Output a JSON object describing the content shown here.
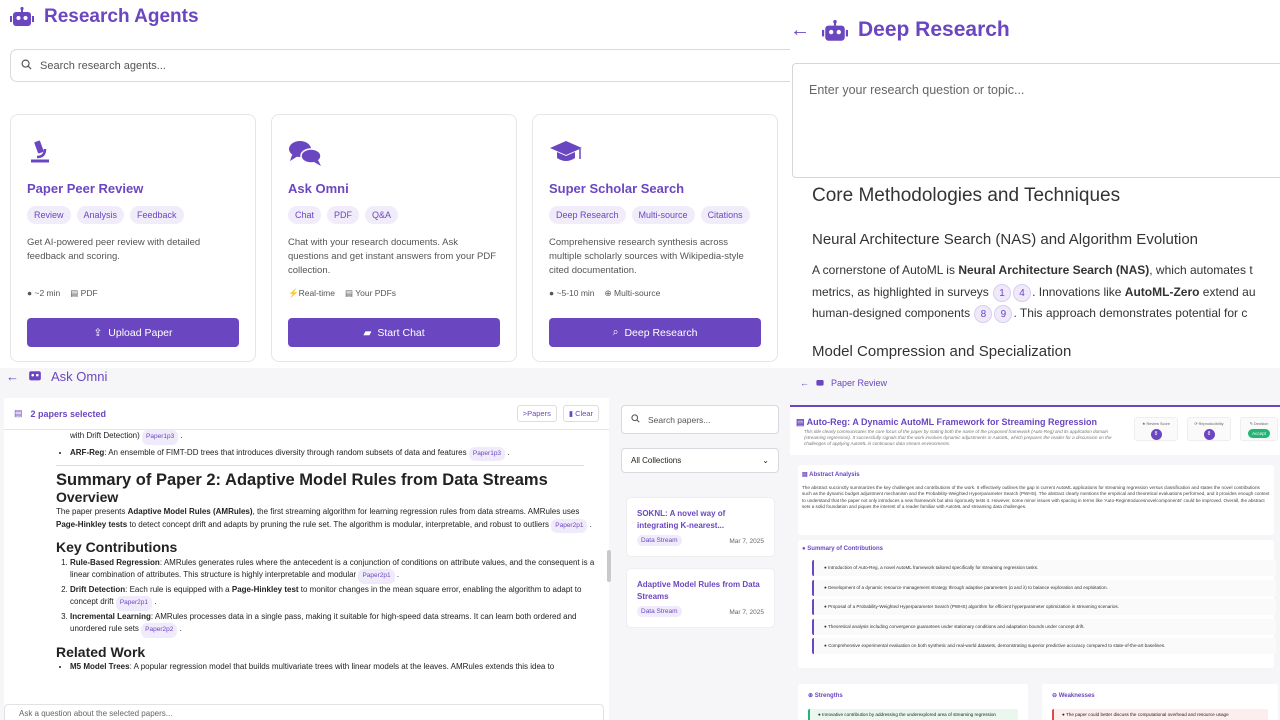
{
  "q1": {
    "app_title": "Research Agents",
    "search_placeholder": "Search research agents...",
    "cards": [
      {
        "title": "Paper Peer Review",
        "tags": [
          "Review",
          "Analysis",
          "Feedback"
        ],
        "desc": "Get AI-powered peer review with detailed feedback and scoring.",
        "meta": [
          "~2 min",
          "PDF"
        ],
        "button": "Upload Paper"
      },
      {
        "title": "Ask Omni",
        "tags": [
          "Chat",
          "PDF",
          "Q&A"
        ],
        "desc": "Chat with your research documents. Ask questions and get instant answers from your PDF collection.",
        "meta": [
          "Real-time",
          "Your PDFs"
        ],
        "button": "Start Chat"
      },
      {
        "title": "Super Scholar Search",
        "tags": [
          "Deep Research",
          "Multi-source",
          "Citations"
        ],
        "desc": "Comprehensive research synthesis across multiple scholarly sources with Wikipedia-style cited documentation.",
        "meta": [
          "~5-10 min",
          "Multi-source"
        ],
        "button": "Deep Research"
      }
    ]
  },
  "q2": {
    "title": "Deep Research",
    "input_placeholder": "Enter your research question or topic...",
    "h2": "Core Methodologies and Techniques",
    "h3": "Neural Architecture Search (NAS) and Algorithm Evolution",
    "p_line1_a": "A cornerstone of AutoML is ",
    "p_line1_b": "Neural Architecture Search (NAS)",
    "p_line1_c": ", which automates t",
    "p_line2_a": "metrics, as highlighted in surveys ",
    "cite1": "1",
    "cite2": "4",
    "p_line2_b": ". Innovations like ",
    "p_line2_c": "AutoML-Zero",
    "p_line2_d": " extend au",
    "p_line3_a": "human-designed components ",
    "cite3": "8",
    "cite4": "9",
    "p_line3_b": ". This approach demonstrates potential for c",
    "h3b": "Model Compression and Specialization"
  },
  "q3": {
    "title": "Ask Omni",
    "selected": "2 papers selected",
    "papers_btn": "Papers",
    "clear_btn": "Clear",
    "top_line": "with Drift Detection)",
    "top_cite": "Paper1p3",
    "arf_label": "ARF-Reg",
    "arf_text": ": An ensemble of FIMT-DD trees that introduces diversity through random subsets of data and features",
    "arf_cite": "Paper1p3",
    "h1": "Summary of Paper 2: Adaptive Model Rules from Data Streams",
    "overview": "Overview",
    "ov_a": "The paper presents ",
    "ov_b": "Adaptive Model Rules (AMRules)",
    "ov_c": ", the first streaming algorithm for learning regression rules from data streams. AMRules uses ",
    "ov_d": "Page-Hinkley tests",
    "ov_e": " to detect concept drift and adapts by pruning the rule set. The algorithm is modular, interpretable, and robust to outliers",
    "ov_cite": "Paper2p1",
    "kc": "Key Contributions",
    "kc1_b": "Rule-Based Regression",
    "kc1": ": AMRules generates rules where the antecedent is a conjunction of conditions on attribute values, and the consequent is a linear combination of attributes. This structure is highly interpretable and modular",
    "kc1_cite": "Paper2p1",
    "kc2_b": "Drift Detection",
    "kc2_a": ": Each rule is equipped with a ",
    "kc2_c": "Page-Hinkley test",
    "kc2_d": " to monitor changes in the mean square error, enabling the algorithm to adapt to concept drift",
    "kc2_cite": "Paper2p1",
    "kc3_b": "Incremental Learning",
    "kc3": ": AMRules processes data in a single pass, making it suitable for high-speed data streams. It can learn both ordered and unordered rule sets",
    "kc3_cite": "Paper2p2",
    "rw": "Related Work",
    "rw1_b": "M5 Model Trees",
    "rw1": ": A popular regression model that builds multivariate trees with linear models at the leaves. AMRules extends this idea to",
    "chat_placeholder": "Ask a question about the selected papers...",
    "side_search": "Search papers...",
    "collection": "All Collections",
    "paper_cards": [
      {
        "title": "SOKNL: A novel way of integrating K-nearest...",
        "badge": "Data Stream",
        "date": "Mar 7, 2025"
      },
      {
        "title": "Adaptive Model Rules from Data Streams",
        "badge": "Data Stream",
        "date": "Mar 7, 2025"
      }
    ]
  },
  "q4": {
    "title": "Paper Review",
    "paper_title": "Auto-Reg: A Dynamic AutoML Framework for Streaming Regression",
    "paper_sub": "This title clearly communicates the core focus of the paper by stating both the name of the proposed framework (Auto-Reg) and its application domain (streaming regression). It successfully signals that the work involves dynamic adjustments in AutoML, which prepares the reader for a discussion on the challenges of applying AutoML in continuous data stream environments.",
    "review_score_label": "Review Score",
    "review_score": "8",
    "repro_label": "Reproducibility",
    "repro": "8",
    "decision_label": "Decision",
    "decision": "Accept",
    "abstract_title": "Abstract Analysis",
    "abstract_text": "The abstract succinctly summarizes the key challenges and contributions of the work. It effectively outlines the gap in current AutoML applications for streaming regression versus classification and states the novel contributions such as the dynamic budget adjustment mechanism and the Probability-Weighted Hyperparameter Search (PWHS). The abstract clearly mentions the empirical and theoretical evaluations performed, and it provides enough context to understand that the paper not only introduces a new framework but also rigorously tests it. However, some minor issues with spacing in terms like 'Auto-Regintroducesnovelcomponents' could be improved. Overall, the abstract sets a solid foundation and piques the interest of a reader familiar with AutoML and streaming data challenges.",
    "contrib_title": "Summary of Contributions",
    "contribs": [
      "Introduction of Auto-Reg, a novel AutoML framework tailored specifically for streaming regression tasks.",
      "Development of a dynamic resource management strategy through adaptive parameters (α and λ) to balance exploration and exploitation.",
      "Proposal of a Probability-Weighted Hyperparameter Search (PWHS) algorithm for efficient hyperparameter optimization in streaming scenarios.",
      "Theoretical analysis including convergence guarantees under stationary conditions and adaptation bounds under concept drift.",
      "Comprehensive experimental evaluation on both synthetic and real-world datasets, demonstrating superior predictive accuracy compared to state-of-the-art baselines."
    ],
    "strengths_title": "Strengths",
    "strength1": "Innovative contribution by addressing the underexplored area of streaming regression",
    "weaknesses_title": "Weaknesses",
    "weakness1": "The paper could better discuss the computational overhead and resource usage"
  }
}
